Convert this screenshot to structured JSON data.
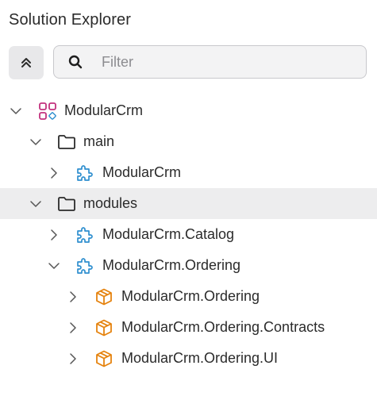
{
  "panel": {
    "title": "Solution Explorer"
  },
  "toolbar": {
    "collapse_icon": "double-chevron-up-icon"
  },
  "search": {
    "placeholder": "Filter",
    "value": ""
  },
  "colors": {
    "solution": "#c2327e",
    "project": "#2f8fcf",
    "package": "#e5830f",
    "folder": "#2b2b2b"
  },
  "tree": {
    "root": {
      "label": "ModularCrm",
      "icon": "solution-icon",
      "expanded": true
    },
    "main": {
      "label": "main",
      "icon": "folder-icon",
      "expanded": true
    },
    "main_project": {
      "label": "ModularCrm",
      "icon": "project-icon",
      "expanded": false
    },
    "modules": {
      "label": "modules",
      "icon": "folder-icon",
      "expanded": true,
      "selected": true
    },
    "catalog": {
      "label": "ModularCrm.Catalog",
      "icon": "project-icon",
      "expanded": false
    },
    "ordering": {
      "label": "ModularCrm.Ordering",
      "icon": "project-icon",
      "expanded": true
    },
    "ordering_pkg": {
      "label": "ModularCrm.Ordering",
      "icon": "package-icon",
      "expanded": false
    },
    "ordering_contracts": {
      "label": "ModularCrm.Ordering.Contracts",
      "icon": "package-icon",
      "expanded": false
    },
    "ordering_ui": {
      "label": "ModularCrm.Ordering.UI",
      "icon": "package-icon",
      "expanded": false
    }
  }
}
